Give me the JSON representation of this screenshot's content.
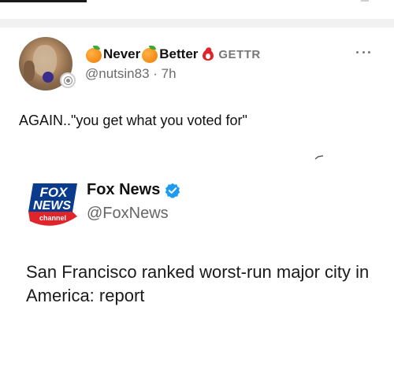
{
  "post": {
    "display_name_part1": "Never",
    "display_name_part2": "Better",
    "platform_label": "GETTR",
    "handle": "@nutsin83",
    "separator": " · ",
    "time_ago": "7h",
    "text": "AGAIN..\"you get what you voted for\""
  },
  "embed": {
    "logo_text_top": "FOX",
    "logo_text_mid": "NEWS",
    "logo_text_bottom": "channel",
    "name": "Fox News",
    "handle": "@FoxNews",
    "headline": "San Francisco ranked worst-run major city in America: report"
  },
  "icons": {
    "name_emoji": "orange-icon",
    "badge": "fire-badge-icon",
    "more": "more-icon",
    "verified": "verified-check-icon"
  },
  "colors": {
    "brand_red": "#e0242b",
    "verified_blue": "#1d9bf0",
    "fox_blue": "#0b3b8c"
  }
}
